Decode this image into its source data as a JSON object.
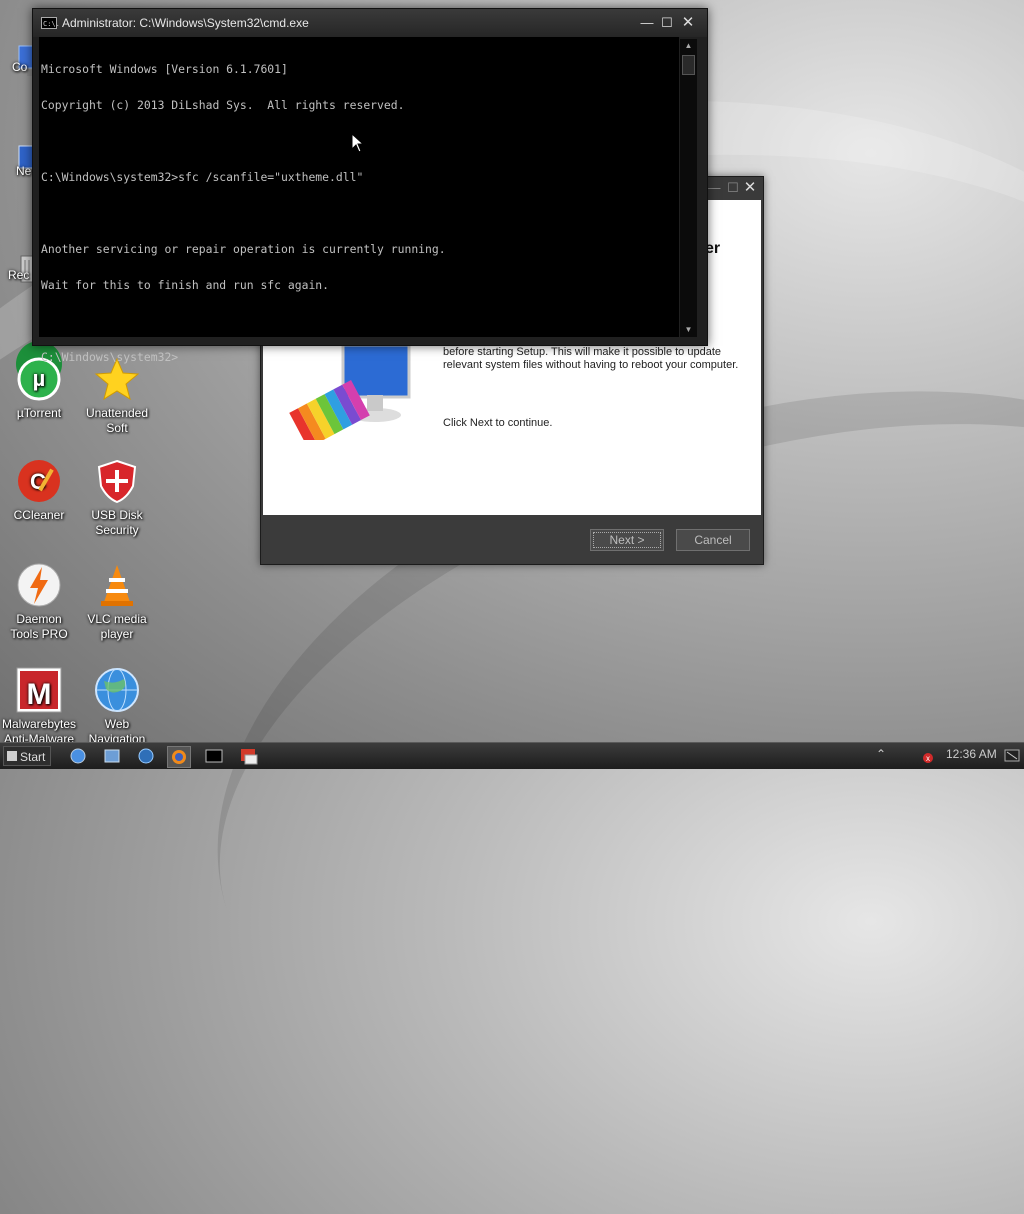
{
  "desktop": {
    "icons": [
      {
        "label": "Co",
        "icon": "computer-icon"
      },
      {
        "label": "Ne",
        "icon": "network-icon"
      },
      {
        "label": "Rec",
        "icon": "recycle-bin-icon"
      },
      {
        "label": "µTorrent",
        "icon": "utorrent-icon"
      },
      {
        "label": "Unattended\nSoft",
        "icon": "star-icon"
      },
      {
        "label": "CCleaner",
        "icon": "ccleaner-icon"
      },
      {
        "label": "USB Disk\nSecurity",
        "icon": "shield-icon"
      },
      {
        "label": "Daemon\nTools PRO",
        "icon": "daemon-tools-icon"
      },
      {
        "label": "VLC media\nplayer",
        "icon": "vlc-cone-icon"
      },
      {
        "label": "Malwarebytes\nAnti-Malware",
        "icon": "malwarebytes-icon"
      },
      {
        "label": "Web\nNavigation",
        "icon": "globe-icon"
      }
    ]
  },
  "cmd_window": {
    "title": "Administrator: C:\\Windows\\System32\\cmd.exe",
    "app_icon_text": "C:\\.",
    "lines": [
      "Microsoft Windows [Version 6.1.7601]",
      "Copyright (c) 2013 DiLshad Sys.  All rights reserved.",
      "",
      "C:\\Windows\\system32>sfc /scanfile=\"uxtheme.dll\"",
      "",
      "Another servicing or repair operation is currently running.",
      "Wait for this to finish and run sfc again.",
      "",
      "C:\\Windows\\system32>"
    ],
    "controls": {
      "minimize": "—",
      "maximize": "☐",
      "close": "✕"
    }
  },
  "setup_window": {
    "title_fragment": "er",
    "body_text_partial": "before starting Setup. This will make it possible to update relevant system files without having to reboot your computer.",
    "body_text_2": "Click Next to continue.",
    "next_label": "Next >",
    "cancel_label": "Cancel",
    "controls": {
      "minimize": "—",
      "maximize": "☐",
      "close": "✕"
    }
  },
  "taskbar": {
    "start_label": "Start",
    "clock": "12:36 AM",
    "tray_arrow": "⌃"
  }
}
